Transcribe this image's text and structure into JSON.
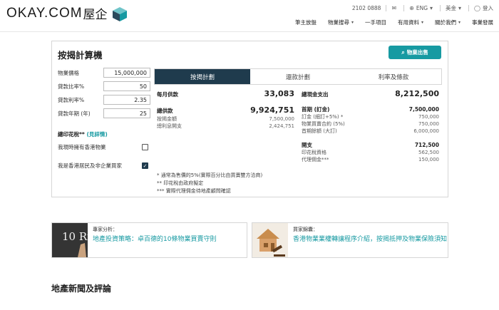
{
  "header": {
    "logo_text": "OKAY.COM",
    "logo_cn": "屋企",
    "phone": "2102 0888",
    "language": "ENG",
    "currency": "美金",
    "login": "登入",
    "nav": [
      {
        "label": "筆主放盤",
        "caret": false
      },
      {
        "label": "物業搜尋",
        "caret": true
      },
      {
        "label": "一手項目",
        "caret": false
      },
      {
        "label": "有用資料",
        "caret": true
      },
      {
        "label": "關於我們",
        "caret": true
      },
      {
        "label": "事業發展",
        "caret": false
      }
    ]
  },
  "calculator": {
    "title": "按揭計算機",
    "cta": "物業出售",
    "inputs": [
      {
        "label": "物業價格",
        "value": "15,000,000"
      },
      {
        "label": "貸款比率%",
        "value": "50"
      },
      {
        "label": "貸款利率%",
        "value": "2.35"
      },
      {
        "label": "貸款年期 (年)",
        "value": "25"
      }
    ],
    "stamp_duty_label": "總印花稅**",
    "stamp_duty_link": "(見詳情)",
    "checkboxes": [
      {
        "label": "我現時擁有香港物業",
        "checked": false
      },
      {
        "label": "我是香港居民及非企業買家",
        "checked": true
      }
    ],
    "tabs": [
      {
        "label": "按揭計劃",
        "active": true
      },
      {
        "label": "還款計劃",
        "active": false
      },
      {
        "label": "利率及條款",
        "active": false
      }
    ],
    "left_results": {
      "monthly_label": "每月供款",
      "monthly_value": "33,083",
      "total_label": "總供款",
      "total_value": "9,924,751",
      "principal_label": "按揭金額",
      "principal_value": "7,500,000",
      "interest_label": "總利息開支",
      "interest_value": "2,424,751"
    },
    "right_results": {
      "cash_label": "總現金支出",
      "cash_value": "8,212,500",
      "down_label": "首期 (訂金)",
      "down_value": "7,500,000",
      "deposit_label": "訂金 (細訂+5%) *",
      "deposit_value": "750,000",
      "contract_label": "物業買賣合約 (5%)",
      "contract_value": "750,000",
      "balance_label": "首期餘額 (大訂)",
      "balance_value": "6,000,000",
      "exp_label": "開支",
      "exp_value": "712,500",
      "stamp_label": "印花稅資格",
      "stamp_value": "562,500",
      "agent_label": "代理佣金***",
      "agent_value": "150,000"
    },
    "notes": [
      "* 通常為售價的5%(實際百分比由買賣雙方洽商)",
      "** 印花稅由政府擬定",
      "*** 實際代理佣金待地產顧問確認"
    ]
  },
  "cards": [
    {
      "category": "專家分析：",
      "title": "地產投資策略：卓百德的10條物業買賣守則",
      "image_text": "10 Rules"
    },
    {
      "category": "買家錦囊：",
      "title": "香港物業業權轉讓程序介紹，按揭抵押及物業保險須知"
    }
  ],
  "section_title": "地產新聞及評論",
  "colors": {
    "accent": "#179aa2",
    "navy": "#1f3b4d"
  }
}
